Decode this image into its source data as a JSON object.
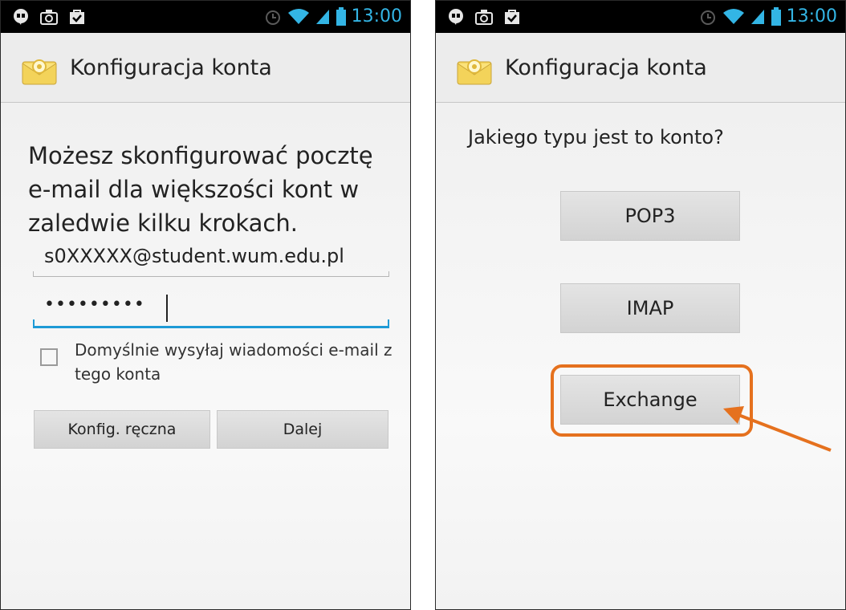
{
  "left_screen": {
    "status": {
      "time": "13:00"
    },
    "header": {
      "title": "Konfiguracja konta"
    },
    "intro": "Możesz skonfigurować pocztę e-mail dla większości kont w zaledwie kilku krokach.",
    "email": {
      "value": "s0XXXXX@student.wum.edu.pl"
    },
    "password": {
      "masked_value": "•••••••••"
    },
    "default_checkbox": {
      "label": "Domyślnie wysyłaj wiadomości e-mail z tego konta",
      "checked": false
    },
    "buttons": {
      "manual": "Konfig. ręczna",
      "next": "Dalej"
    }
  },
  "right_screen": {
    "status": {
      "time": "13:00"
    },
    "header": {
      "title": "Konfiguracja konta"
    },
    "question": "Jakiego typu jest to konto?",
    "account_types": {
      "pop3": "POP3",
      "imap": "IMAP",
      "exchange": "Exchange"
    }
  },
  "annotation": {
    "highlight_color": "#e5711e"
  },
  "colors": {
    "status_accent": "#33b5e5",
    "focus_underline": "#1e9ad6"
  }
}
